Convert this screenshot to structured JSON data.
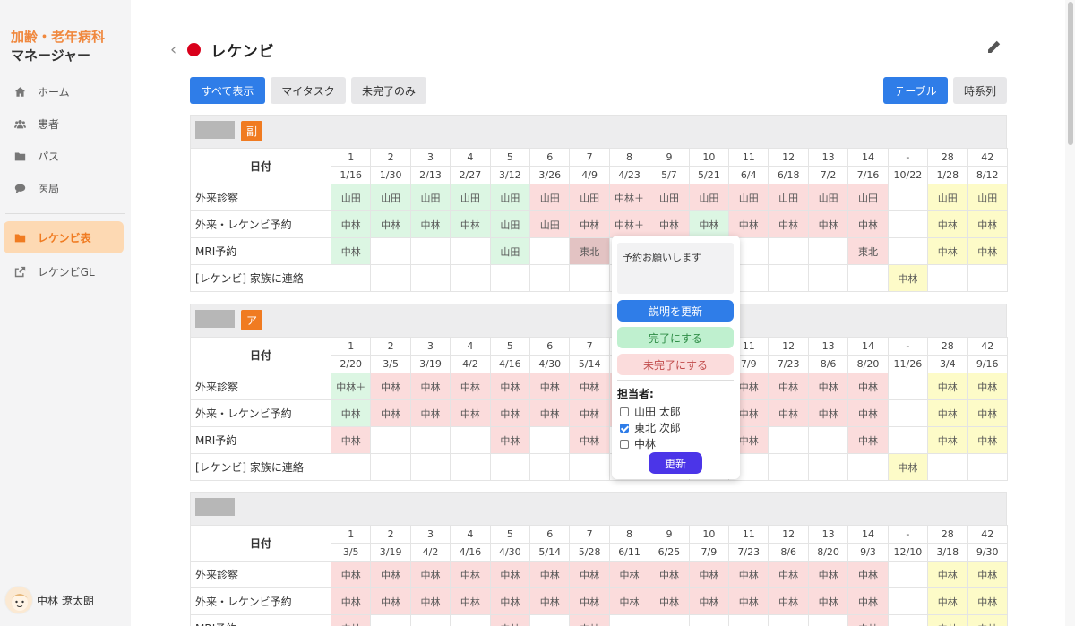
{
  "app": {
    "brand_line1": "加齢・老年病科",
    "brand_line2": "マネージャー"
  },
  "sidebar": {
    "items": [
      {
        "label": "ホーム",
        "icon": "home-icon"
      },
      {
        "label": "患者",
        "icon": "users-icon"
      },
      {
        "label": "パス",
        "icon": "folder-icon"
      },
      {
        "label": "医局",
        "icon": "chat-icon"
      }
    ],
    "active_item": {
      "label": "レケンビ表",
      "icon": "folder-icon"
    },
    "external_item": {
      "label": "レケンビGL",
      "icon": "external-link-icon"
    },
    "user_name": "中林 遼太朗",
    "accent_color": "#f07b21"
  },
  "header": {
    "title": "レケンビ",
    "dot_color": "#d9001b"
  },
  "filters": {
    "all": "すべて表示",
    "mine": "マイタスク",
    "incomplete": "未完了のみ"
  },
  "views": {
    "table": "テーブル",
    "timeline": "時系列"
  },
  "sections": [
    {
      "tag": "副",
      "date_header": "日付",
      "numbers": [
        "1",
        "2",
        "3",
        "4",
        "5",
        "6",
        "7",
        "8",
        "9",
        "10",
        "11",
        "12",
        "13",
        "14",
        "-",
        "28",
        "42"
      ],
      "dates": [
        "1/16",
        "1/30",
        "2/13",
        "2/27",
        "3/12",
        "3/26",
        "4/9",
        "4/23",
        "5/7",
        "5/21",
        "6/4",
        "6/18",
        "7/2",
        "7/16",
        "10/22",
        "1/28",
        "8/12"
      ],
      "rows": [
        {
          "label": "外来診察",
          "cells": [
            [
              "山田",
              "g"
            ],
            [
              "山田",
              "g"
            ],
            [
              "山田",
              "g"
            ],
            [
              "山田",
              "g"
            ],
            [
              "山田",
              "g"
            ],
            [
              "山田",
              "r"
            ],
            [
              "山田",
              "r"
            ],
            [
              "中林＋",
              "r"
            ],
            [
              "山田",
              "r"
            ],
            [
              "山田",
              "r"
            ],
            [
              "山田",
              "r"
            ],
            [
              "山田",
              "r"
            ],
            [
              "山田",
              "r"
            ],
            [
              "山田",
              "r"
            ],
            [
              "",
              ""
            ],
            [
              "山田",
              "y"
            ],
            [
              "山田",
              "y"
            ]
          ]
        },
        {
          "label": "外来・レケンビ予約",
          "cells": [
            [
              "中林",
              "g"
            ],
            [
              "中林",
              "g"
            ],
            [
              "中林",
              "g"
            ],
            [
              "中林",
              "g"
            ],
            [
              "山田",
              "g"
            ],
            [
              "山田",
              "r"
            ],
            [
              "中林",
              "r"
            ],
            [
              "中林＋",
              "r"
            ],
            [
              "中林",
              "r"
            ],
            [
              "中林",
              "g"
            ],
            [
              "中林",
              "r"
            ],
            [
              "中林",
              "r"
            ],
            [
              "中林",
              "r"
            ],
            [
              "中林",
              "r"
            ],
            [
              "",
              ""
            ],
            [
              "中林",
              "y"
            ],
            [
              "中林",
              "y"
            ]
          ]
        },
        {
          "label": "MRI予約",
          "cells": [
            [
              "中林",
              "g"
            ],
            [
              "",
              ""
            ],
            [
              "",
              ""
            ],
            [
              "",
              ""
            ],
            [
              "山田",
              "g"
            ],
            [
              "",
              ""
            ],
            [
              "東北",
              "rd"
            ],
            [
              "",
              ""
            ],
            [
              "",
              ""
            ],
            [
              "",
              ""
            ],
            [
              "",
              ""
            ],
            [
              "",
              ""
            ],
            [
              "",
              ""
            ],
            [
              "東北",
              "r"
            ],
            [
              "",
              ""
            ],
            [
              "中林",
              "y"
            ],
            [
              "中林",
              "y"
            ]
          ]
        },
        {
          "label": "[レケンビ] 家族に連絡",
          "cells": [
            [
              "",
              ""
            ],
            [
              "",
              ""
            ],
            [
              "",
              ""
            ],
            [
              "",
              ""
            ],
            [
              "",
              ""
            ],
            [
              "",
              ""
            ],
            [
              "",
              ""
            ],
            [
              "",
              ""
            ],
            [
              "",
              ""
            ],
            [
              "",
              ""
            ],
            [
              "",
              ""
            ],
            [
              "",
              ""
            ],
            [
              "",
              ""
            ],
            [
              "",
              ""
            ],
            [
              "中林",
              "y"
            ],
            [
              "",
              ""
            ],
            [
              "",
              ""
            ]
          ]
        }
      ]
    },
    {
      "tag": "ア",
      "date_header": "日付",
      "numbers": [
        "1",
        "2",
        "3",
        "4",
        "5",
        "6",
        "7",
        "8",
        "9",
        "10",
        "11",
        "12",
        "13",
        "14",
        "-",
        "28",
        "42"
      ],
      "dates": [
        "2/20",
        "3/5",
        "3/19",
        "4/2",
        "4/16",
        "4/30",
        "5/14",
        "5/28",
        "6/11",
        "6/25",
        "7/9",
        "7/23",
        "8/6",
        "8/20",
        "11/26",
        "3/4",
        "9/16"
      ],
      "rows": [
        {
          "label": "外来診察",
          "cells": [
            [
              "中林＋",
              "g"
            ],
            [
              "中林",
              "r"
            ],
            [
              "中林",
              "r"
            ],
            [
              "中林",
              "r"
            ],
            [
              "中林",
              "r"
            ],
            [
              "中林",
              "r"
            ],
            [
              "中林",
              "r"
            ],
            [
              "中林",
              "r"
            ],
            [
              "中林",
              "r"
            ],
            [
              "中林",
              "r"
            ],
            [
              "中林",
              "r"
            ],
            [
              "中林",
              "r"
            ],
            [
              "中林",
              "r"
            ],
            [
              "中林",
              "r"
            ],
            [
              "",
              ""
            ],
            [
              "中林",
              "y"
            ],
            [
              "中林",
              "y"
            ]
          ]
        },
        {
          "label": "外来・レケンビ予約",
          "cells": [
            [
              "中林",
              "g"
            ],
            [
              "中林",
              "r"
            ],
            [
              "中林",
              "r"
            ],
            [
              "中林",
              "r"
            ],
            [
              "中林",
              "r"
            ],
            [
              "中林",
              "r"
            ],
            [
              "中林",
              "r"
            ],
            [
              "中林",
              "r"
            ],
            [
              "中林",
              "r"
            ],
            [
              "中林",
              "r"
            ],
            [
              "中林",
              "r"
            ],
            [
              "中林",
              "r"
            ],
            [
              "中林",
              "r"
            ],
            [
              "中林",
              "r"
            ],
            [
              "",
              ""
            ],
            [
              "中林",
              "y"
            ],
            [
              "中林",
              "y"
            ]
          ]
        },
        {
          "label": "MRI予約",
          "cells": [
            [
              "中林",
              "r"
            ],
            [
              "",
              ""
            ],
            [
              "",
              ""
            ],
            [
              "",
              ""
            ],
            [
              "中林",
              "r"
            ],
            [
              "",
              ""
            ],
            [
              "中林",
              "r"
            ],
            [
              "",
              ""
            ],
            [
              "",
              ""
            ],
            [
              "",
              ""
            ],
            [
              "中林",
              "r"
            ],
            [
              "",
              ""
            ],
            [
              "",
              ""
            ],
            [
              "中林",
              "r"
            ],
            [
              "",
              ""
            ],
            [
              "中林",
              "y"
            ],
            [
              "中林",
              "y"
            ]
          ]
        },
        {
          "label": "[レケンビ] 家族に連絡",
          "cells": [
            [
              "",
              ""
            ],
            [
              "",
              ""
            ],
            [
              "",
              ""
            ],
            [
              "",
              ""
            ],
            [
              "",
              ""
            ],
            [
              "",
              ""
            ],
            [
              "",
              ""
            ],
            [
              "",
              ""
            ],
            [
              "",
              ""
            ],
            [
              "",
              ""
            ],
            [
              "",
              ""
            ],
            [
              "",
              ""
            ],
            [
              "",
              ""
            ],
            [
              "",
              ""
            ],
            [
              "中林",
              "y"
            ],
            [
              "",
              ""
            ],
            [
              "",
              ""
            ]
          ]
        }
      ]
    },
    {
      "tag": "",
      "date_header": "日付",
      "numbers": [
        "1",
        "2",
        "3",
        "4",
        "5",
        "6",
        "7",
        "8",
        "9",
        "10",
        "11",
        "12",
        "13",
        "14",
        "-",
        "28",
        "42"
      ],
      "dates": [
        "3/5",
        "3/19",
        "4/2",
        "4/16",
        "4/30",
        "5/14",
        "5/28",
        "6/11",
        "6/25",
        "7/9",
        "7/23",
        "8/6",
        "8/20",
        "9/3",
        "12/10",
        "3/18",
        "9/30"
      ],
      "rows": [
        {
          "label": "外来診察",
          "cells": [
            [
              "中林",
              "r"
            ],
            [
              "中林",
              "r"
            ],
            [
              "中林",
              "r"
            ],
            [
              "中林",
              "r"
            ],
            [
              "中林",
              "r"
            ],
            [
              "中林",
              "r"
            ],
            [
              "中林",
              "r"
            ],
            [
              "中林",
              "r"
            ],
            [
              "中林",
              "r"
            ],
            [
              "中林",
              "r"
            ],
            [
              "中林",
              "r"
            ],
            [
              "中林",
              "r"
            ],
            [
              "中林",
              "r"
            ],
            [
              "中林",
              "r"
            ],
            [
              "",
              ""
            ],
            [
              "中林",
              "y"
            ],
            [
              "中林",
              "y"
            ]
          ]
        },
        {
          "label": "外来・レケンビ予約",
          "cells": [
            [
              "中林",
              "r"
            ],
            [
              "中林",
              "r"
            ],
            [
              "中林",
              "r"
            ],
            [
              "中林",
              "r"
            ],
            [
              "中林",
              "r"
            ],
            [
              "中林",
              "r"
            ],
            [
              "中林",
              "r"
            ],
            [
              "中林",
              "r"
            ],
            [
              "中林",
              "r"
            ],
            [
              "中林",
              "r"
            ],
            [
              "中林",
              "r"
            ],
            [
              "中林",
              "r"
            ],
            [
              "中林",
              "r"
            ],
            [
              "中林",
              "r"
            ],
            [
              "",
              ""
            ],
            [
              "中林",
              "y"
            ],
            [
              "中林",
              "y"
            ]
          ]
        },
        {
          "label": "MRI予約",
          "cells": [
            [
              "中林",
              "r"
            ],
            [
              "",
              ""
            ],
            [
              "",
              ""
            ],
            [
              "",
              ""
            ],
            [
              "中林",
              "r"
            ],
            [
              "",
              ""
            ],
            [
              "中林",
              "r"
            ],
            [
              "",
              ""
            ],
            [
              "",
              ""
            ],
            [
              "",
              ""
            ],
            [
              "",
              ""
            ],
            [
              "",
              ""
            ],
            [
              "",
              ""
            ],
            [
              "中林",
              "r"
            ],
            [
              "",
              ""
            ],
            [
              "中林",
              "y"
            ],
            [
              "中林",
              "y"
            ]
          ]
        }
      ]
    }
  ],
  "popup": {
    "note": "予約お願いします",
    "update_description": "説明を更新",
    "mark_complete": "完了にする",
    "mark_incomplete": "未完了にする",
    "assignee_label": "担当者:",
    "assignees": [
      {
        "name": "山田 太郎",
        "checked": false
      },
      {
        "name": "東北 次郎",
        "checked": true
      },
      {
        "name": "中林",
        "checked": false
      }
    ],
    "update": "更新"
  }
}
